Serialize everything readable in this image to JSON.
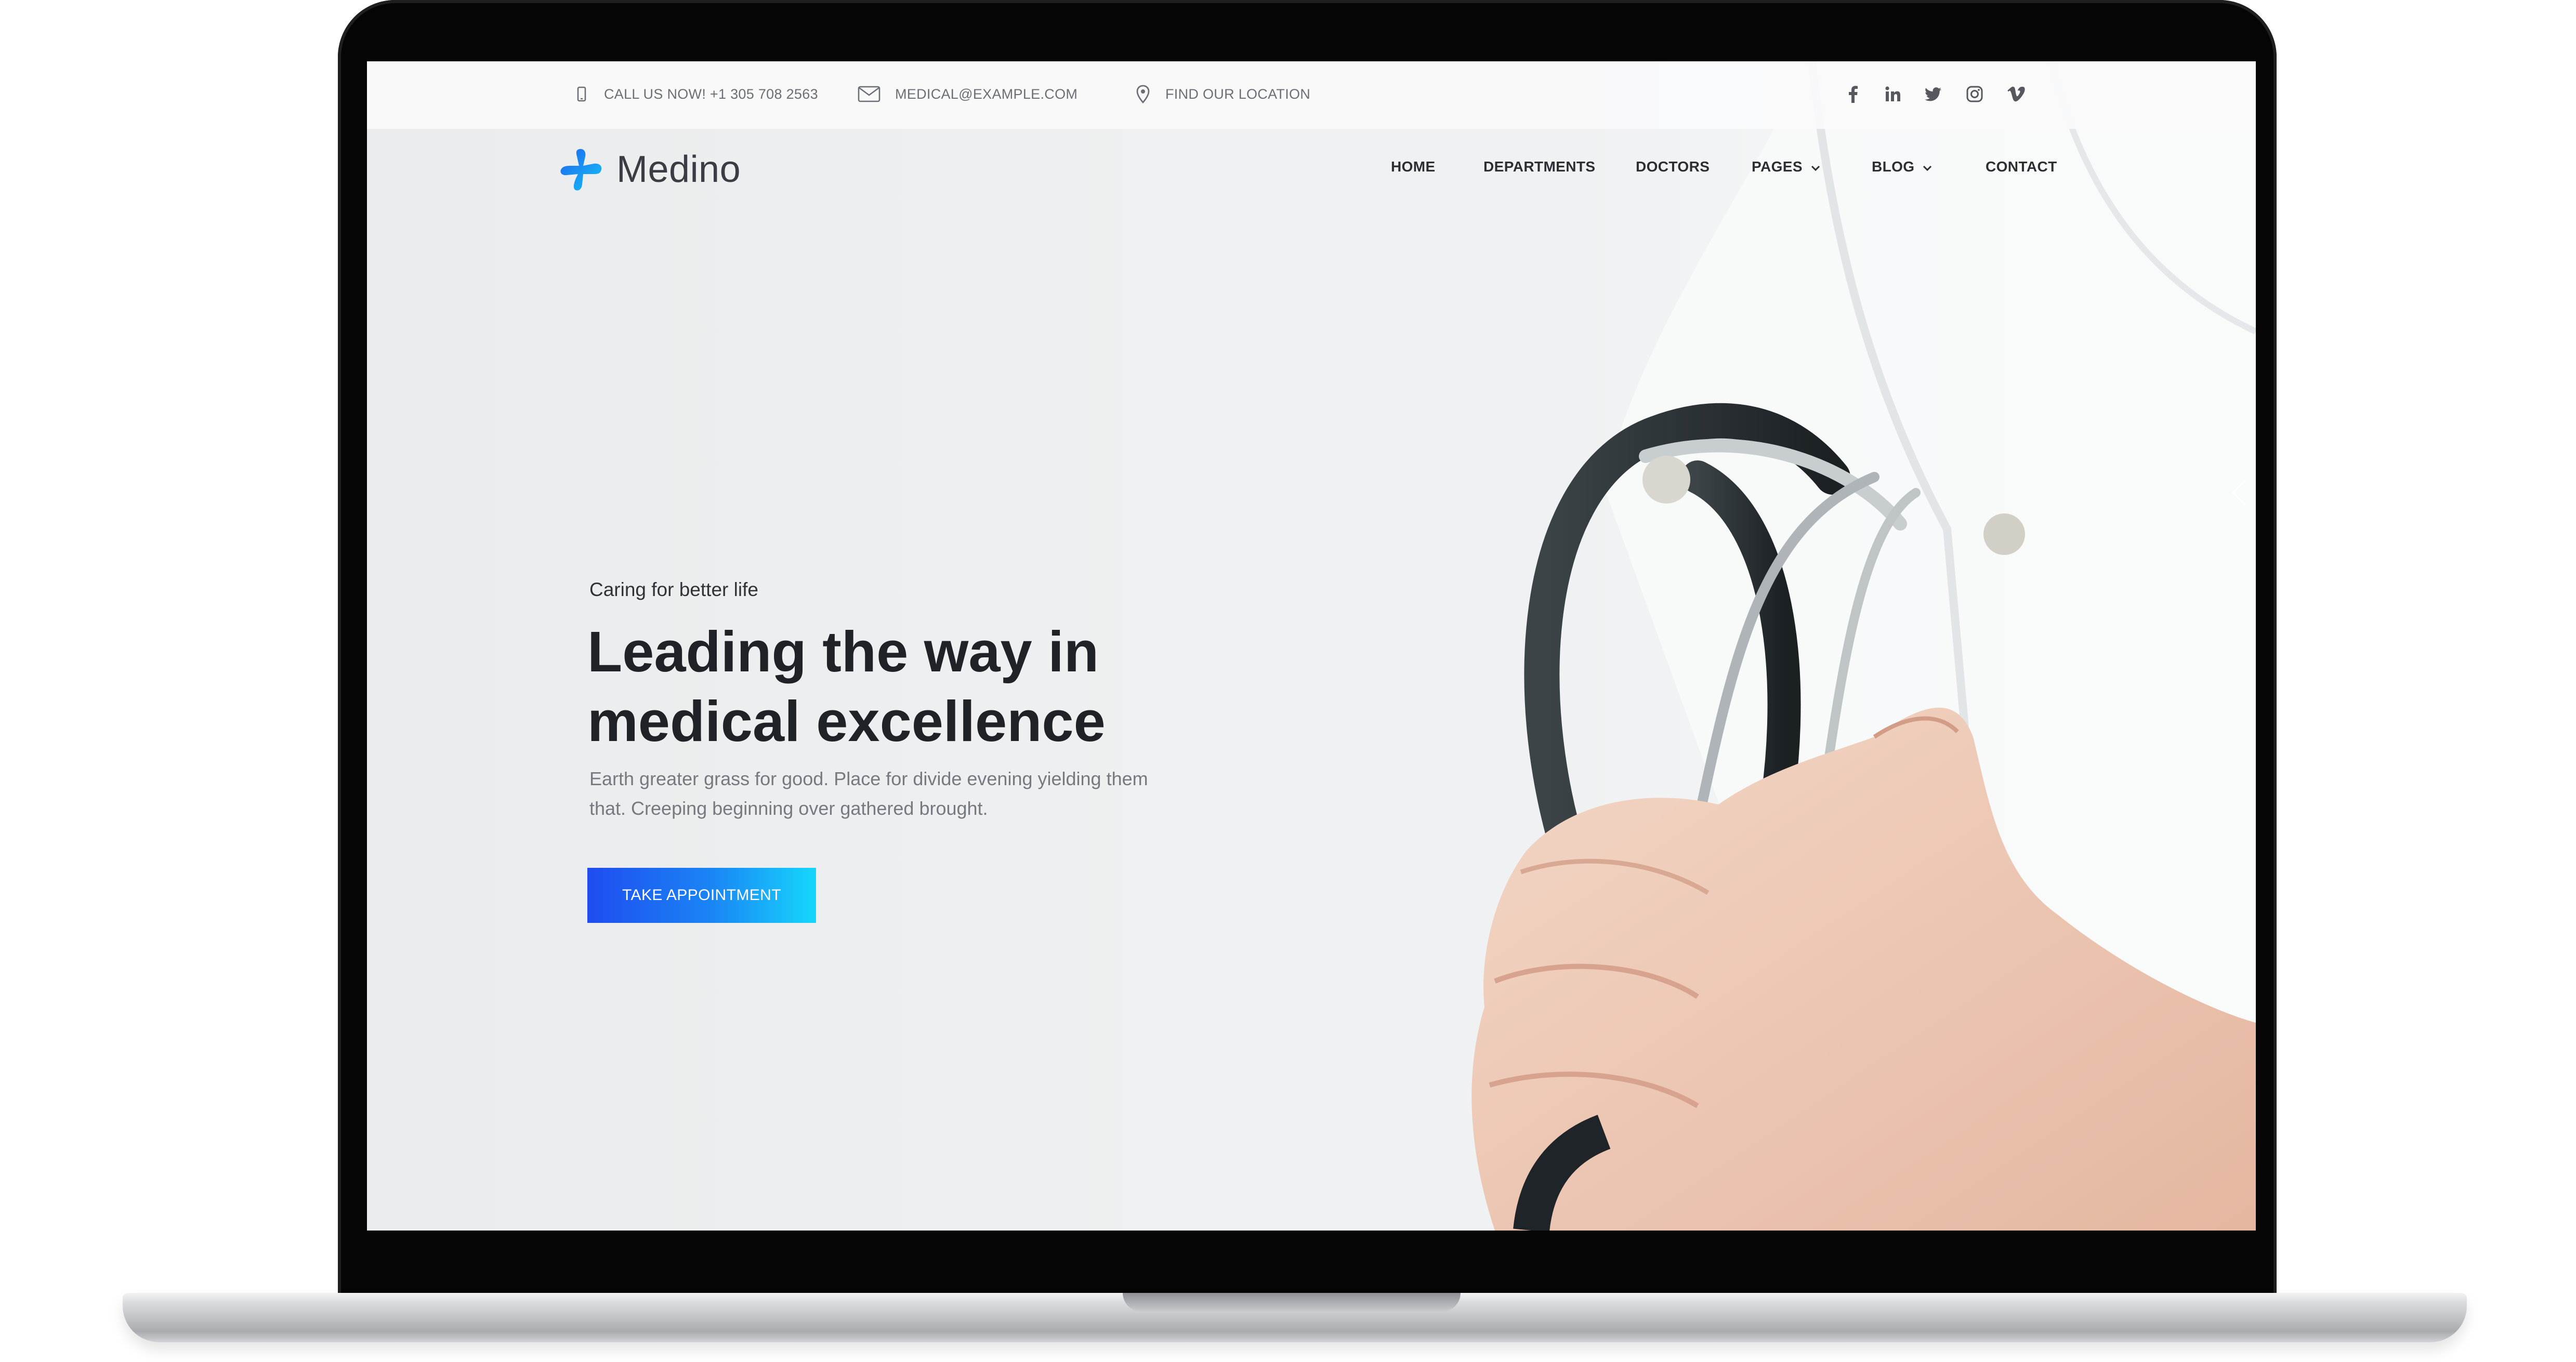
{
  "topbar": {
    "phone": "CALL US NOW! +1 305 708 2563",
    "email": "MEDICAL@EXAMPLE.COM",
    "location": "FIND OUR LOCATION",
    "social": [
      "facebook-icon",
      "linkedin-icon",
      "twitter-icon",
      "instagram-icon",
      "vimeo-icon"
    ]
  },
  "brand": {
    "name": "Medino",
    "colors": {
      "blue": "#1f4cf0",
      "cyan": "#16d7fc"
    }
  },
  "nav": {
    "items": [
      {
        "label": "HOME"
      },
      {
        "label": "DEPARTMENTS"
      },
      {
        "label": "DOCTORS"
      },
      {
        "label": "PAGES",
        "dropdown": true
      },
      {
        "label": "BLOG",
        "dropdown": true
      },
      {
        "label": "CONTACT"
      }
    ]
  },
  "hero": {
    "eyebrow": "Caring for better life",
    "title_line1": "Leading the way in",
    "title_line2": "medical excellence",
    "description": "Earth greater grass for good. Place for divide evening yielding them that. Creeping beginning over gathered brought.",
    "cta_label": "TAKE APPOINTMENT",
    "cta_gradient": [
      "#1f4cf0",
      "#16d7fc"
    ]
  }
}
